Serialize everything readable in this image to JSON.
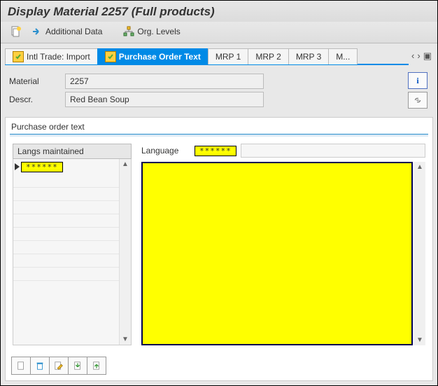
{
  "header": {
    "title": "Display Material 2257 (Full products)"
  },
  "toolbar": {
    "additional_data": "Additional Data",
    "org_levels": "Org. Levels"
  },
  "tabs": {
    "items": [
      {
        "label": "Intl Trade: Import"
      },
      {
        "label": "Purchase Order Text"
      },
      {
        "label": "MRP 1"
      },
      {
        "label": "MRP 2"
      },
      {
        "label": "MRP 3"
      },
      {
        "label": "M..."
      }
    ]
  },
  "fields": {
    "material_label": "Material",
    "material_value": "2257",
    "descr_label": "Descr.",
    "descr_value": "Red Bean Soup"
  },
  "panel": {
    "title": "Purchase order text",
    "langs_header": "Langs maintained",
    "lang_value0": "******",
    "language_label": "Language",
    "language_value": "******"
  },
  "icon_names": {
    "new": "new-icon",
    "additional": "arrow-right-icon",
    "org": "org-levels-icon",
    "info": "info-icon",
    "link": "link-icon",
    "create": "page-icon",
    "delete": "trash-icon",
    "edit": "edit-icon",
    "copy_in": "page-copy-in-icon",
    "copy_out": "page-copy-out-icon"
  }
}
